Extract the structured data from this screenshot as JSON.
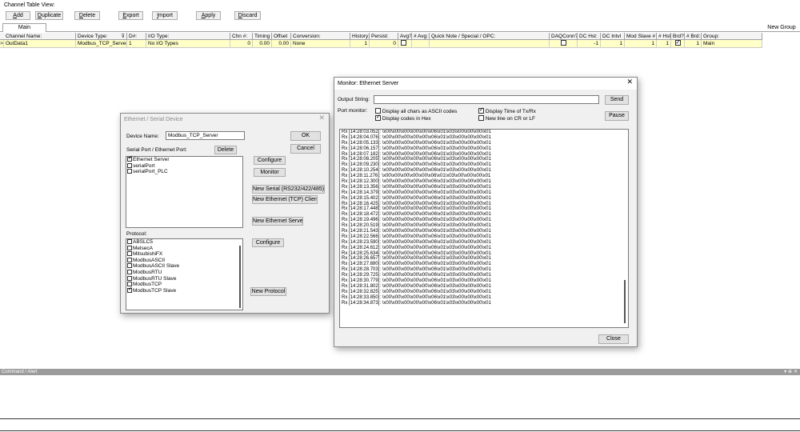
{
  "toolbar": {
    "section_label": "Channel Table View:",
    "buttons": [
      "Add",
      "Duplicate",
      "Delete",
      "Export",
      "Import",
      "Apply",
      "Discard"
    ]
  },
  "tabs": {
    "main": "Main",
    "new_group": "New Group"
  },
  "grid": {
    "headers": [
      "Channel Name:",
      "Device Type:",
      "D#:",
      "I/O Type:",
      "Chn #:",
      "Timing",
      "Offset",
      "Conversion:",
      "History:",
      "Persist:",
      "Avg?",
      "# Avg:",
      "Quick Note / Special / OPC:",
      "DAQConn?",
      "DC Hst:",
      "DC Intvl",
      "Mod Slave #",
      "# Hst:",
      "Brd?",
      "# Brd:",
      "Group:"
    ],
    "row": {
      "marker": ">",
      "channel_name": "OutData1",
      "device_type": "Modbus_TCP_Server",
      "d_num": "1",
      "io_type": "No I/O Types",
      "chn": "0",
      "timing": "0.00",
      "offset": "0.00",
      "conversion": "None",
      "history": "1",
      "persist": "0",
      "dc_hst": "-1",
      "dc_intvl": "1",
      "mod_slave": "1",
      "hst": "1",
      "brd": "1",
      "group": "Main"
    }
  },
  "device_dialog": {
    "title": "Ethernet / Serial Device",
    "device_name_label": "Device Name:",
    "device_name_value": "Modbus_TCP_Server",
    "ok": "OK",
    "cancel": "Cancel",
    "ports_label": "Serial Port / Ethernet Port:",
    "delete": "Delete",
    "ports": [
      {
        "name": "Ethernet Server",
        "checked": true
      },
      {
        "name": "serialPort",
        "checked": false
      },
      {
        "name": "serialPort_PLC",
        "checked": false
      }
    ],
    "configure": "Configure",
    "monitor": "Monitor",
    "new_serial": "New Serial (RS232/422/485)",
    "new_eth_client": "New Ethernet (TCP) Client",
    "new_eth_server": "New Ethernet Server",
    "protocol_label": "Protocol:",
    "protocols": [
      {
        "name": "ABSLC5",
        "checked": false
      },
      {
        "name": "MelsecA",
        "checked": false
      },
      {
        "name": "MitsubishiFX",
        "checked": false
      },
      {
        "name": "ModbusASCII",
        "checked": false
      },
      {
        "name": "ModbusASCII Slave",
        "checked": false
      },
      {
        "name": "ModbusRTU",
        "checked": false
      },
      {
        "name": "ModbusRTU Slave",
        "checked": false
      },
      {
        "name": "ModbusTCP",
        "checked": false
      },
      {
        "name": "ModbusTCP Slave",
        "checked": true
      }
    ],
    "protocol_configure": "Configure",
    "new_protocol": "New Protocol"
  },
  "monitor_dialog": {
    "title": "Monitor: Ethernet Server",
    "output_label": "Output String:",
    "send": "Send",
    "port_monitor_label": "Port monitor:",
    "opt_ascii": "Display all chars as ASCII codes",
    "opt_hex": "Display codes in Hex",
    "opt_time": "Display Time of Tx/Rx",
    "opt_newline": "New line on CR or LF",
    "pause": "Pause",
    "close": "Close",
    "log_payload": "\\x00\\x00\\x00\\x00\\x00\\x06\\x01\\x03\\x00\\x00\\x00\\x01",
    "log_times": [
      "14:28:03.052",
      "14:28:04.076",
      "14:28:05.133",
      "14:28:06.157",
      "14:28:07.182",
      "14:28:08.205",
      "14:28:09.230",
      "14:28:10.254",
      "14:28:11.276",
      "14:28:12.300",
      "14:28:13.356",
      "14:28:14.379",
      "14:28:15.402",
      "14:28:16.425",
      "14:28:17.448",
      "14:28:18.472",
      "14:28:19.496",
      "14:28:20.519",
      "14:28:21.543",
      "14:28:22.566",
      "14:28:23.590",
      "14:28:24.612",
      "14:28:25.634",
      "14:28:26.657",
      "14:28:27.680",
      "14:28:28.703",
      "14:28:29.725",
      "14:28:30.779",
      "14:28:31.802",
      "14:28:32.825",
      "14:28:33.850",
      "14:28:34.873"
    ]
  },
  "command_bar": {
    "title": "Command / Alert",
    "controls": "▾ ⊕ ✕"
  },
  "colors": {
    "row_highlight": "#ffffc8",
    "command_bar": "#9b9b9b",
    "dialog_bg": "#f0f0f0"
  }
}
